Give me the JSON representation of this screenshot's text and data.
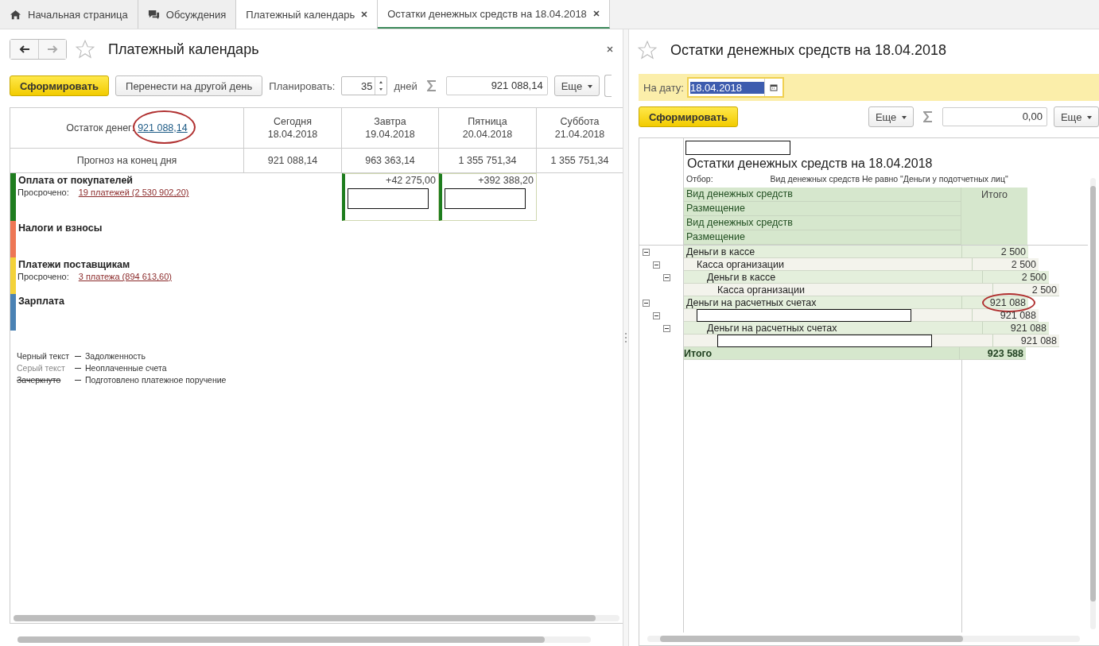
{
  "tabs": [
    {
      "label": "Начальная страница",
      "closable": false,
      "selected": false
    },
    {
      "label": "Обсуждения",
      "closable": false,
      "selected": false
    },
    {
      "label": "Платежный календарь",
      "closable": true,
      "selected": false
    },
    {
      "label": "Остатки денежных средств на 18.04.2018",
      "closable": true,
      "selected": true
    }
  ],
  "left": {
    "title": "Платежный календарь",
    "generate": "Сформировать",
    "move": "Перенести на другой день",
    "plan_label": "Планировать:",
    "plan_days": "35",
    "days_label": "дней",
    "sum": "921 088,14",
    "more": "Еще",
    "balance_label": "Остаток денег:",
    "balance_value": "921 088,14",
    "balance_circled": true,
    "days": [
      {
        "weekday": "Сегодня",
        "date": "18.04.2018"
      },
      {
        "weekday": "Завтра",
        "date": "19.04.2018"
      },
      {
        "weekday": "Пятница",
        "date": "20.04.2018"
      },
      {
        "weekday": "Суббота",
        "date": "21.04.2018"
      }
    ],
    "forecast_label": "Прогноз на конец дня",
    "forecast": [
      "921 088,14",
      "963 363,14",
      "1 355 751,34",
      "1 355 751,34"
    ],
    "categories": [
      {
        "name": "Оплата от покупателей",
        "color": "#1e7d1e",
        "overdue_label": "Просрочено:",
        "overdue_link": "19 платежей (2 530 902,20)",
        "cells": [
          {
            "kind": "empty"
          },
          {
            "kind": "amount",
            "amount": "+42 275,00",
            "redacted": true
          },
          {
            "kind": "amount",
            "amount": "+392 388,20",
            "redacted": true
          },
          {
            "kind": "empty"
          }
        ]
      },
      {
        "name": "Налоги и взносы",
        "color": "#ee7755"
      },
      {
        "name": "Платежи поставщикам",
        "color": "#f3d23a",
        "overdue_label": "Просрочено:",
        "overdue_link": "3 платежа (894 613,60)"
      },
      {
        "name": "Зарплата",
        "color": "#4a82b4"
      }
    ],
    "legend": [
      {
        "sample": "Черный текст",
        "meaning": "Задолженность",
        "kind": "plain"
      },
      {
        "sample": "Серый текст",
        "meaning": "Неоплаченные счета",
        "kind": "grey"
      },
      {
        "sample": "Зачеркнуто",
        "meaning": "Подготовлено платежное поручение",
        "kind": "strike"
      }
    ]
  },
  "right": {
    "title": "Остатки денежных средств на 18.04.2018",
    "date_label": "На дату:",
    "date": "18.04.2018",
    "generate": "Сформировать",
    "more": "Еще",
    "sum": "0,00",
    "more2": "Еще",
    "report": {
      "title_redacted": true,
      "title": "Остатки денежных средств на 18.04.2018",
      "filter_label": "Отбор:",
      "filter": "Вид денежных средств Не равно \"Деньги у подотчетных лиц\"",
      "header_rows": [
        "Вид денежных средств",
        "Размещение",
        "Вид денежных средств",
        "Размещение"
      ],
      "total_header": "Итого",
      "rows": [
        {
          "name": "Деньги в кассе",
          "total": "2 500",
          "expanded": true,
          "children": [
            {
              "name": "Касса организации",
              "total": "2 500",
              "expanded": true,
              "children": [
                {
                  "name": "Деньги в кассе",
                  "total": "2 500",
                  "expanded": true,
                  "children": [
                    {
                      "name": "Касса организации",
                      "total": "2 500"
                    }
                  ]
                }
              ]
            }
          ]
        },
        {
          "name": "Деньги на расчетных счетах",
          "total": "921 088",
          "expanded": true,
          "circled": true,
          "children": [
            {
              "total": "921 088",
              "expanded": true,
              "redacted": true,
              "children": [
                {
                  "name": "Деньги на расчетных счетах",
                  "total": "921 088",
                  "expanded": true,
                  "children": [
                    {
                      "total": "921 088",
                      "redacted": true
                    }
                  ]
                }
              ]
            }
          ]
        }
      ],
      "grand_label": "Итого",
      "grand_total": "923 588"
    }
  }
}
